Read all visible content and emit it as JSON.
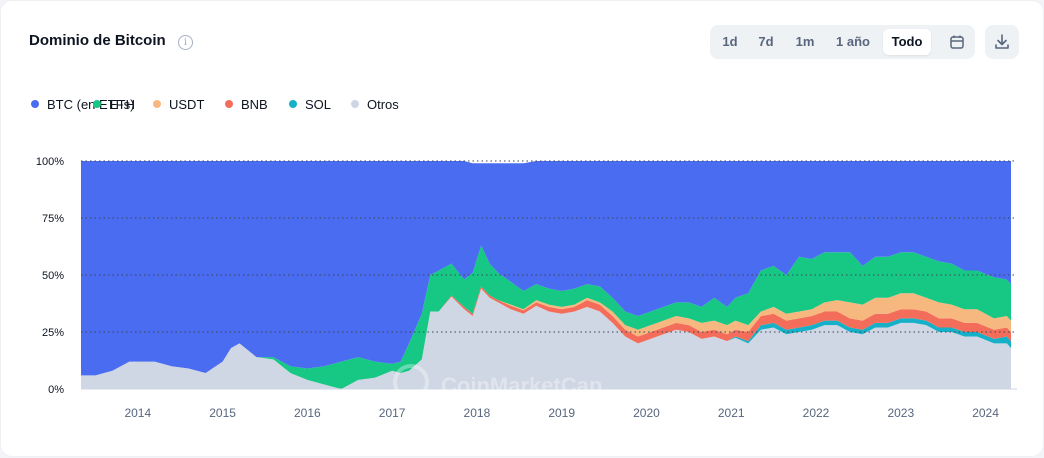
{
  "title": "Dominio de Bitcoin",
  "info_icon": "info-icon",
  "range_buttons": [
    {
      "label": "1d",
      "active": false
    },
    {
      "label": "7d",
      "active": false
    },
    {
      "label": "1m",
      "active": false
    },
    {
      "label": "1 año",
      "active": false
    },
    {
      "label": "Todo",
      "active": true
    }
  ],
  "icons": {
    "calendar": "calendar-icon",
    "download": "download-icon"
  },
  "colors": {
    "btc": "#4a6cf0",
    "eth": "#17c784",
    "usdt": "#f6b87e",
    "bnb": "#f46d5a",
    "sol": "#16b0c8",
    "others": "#cfd6e4"
  },
  "legend": [
    {
      "label": "BTC (en ETFs)",
      "color": "#4a6cf0"
    },
    {
      "label": "ETH",
      "color": "#17c784"
    },
    {
      "label": "USDT",
      "color": "#f6b87e"
    },
    {
      "label": "BNB",
      "color": "#f46d5a"
    },
    {
      "label": "SOL",
      "color": "#16b0c8"
    },
    {
      "label": "Otros",
      "color": "#cfd6e4"
    }
  ],
  "watermark": "CoinMarketCap",
  "chart_data": {
    "type": "area",
    "stacked": true,
    "x": [
      2013.33,
      2013.5,
      2013.7,
      2013.9,
      2014.0,
      2014.2,
      2014.4,
      2014.6,
      2014.8,
      2015.0,
      2015.1,
      2015.2,
      2015.4,
      2015.6,
      2015.8,
      2016.0,
      2016.2,
      2016.4,
      2016.6,
      2016.8,
      2017.0,
      2017.1,
      2017.2,
      2017.35,
      2017.45,
      2017.55,
      2017.7,
      2017.85,
      2017.95,
      2018.05,
      2018.15,
      2018.25,
      2018.4,
      2018.55,
      2018.7,
      2018.85,
      2019.0,
      2019.15,
      2019.3,
      2019.45,
      2019.6,
      2019.75,
      2019.9,
      2020.05,
      2020.2,
      2020.35,
      2020.5,
      2020.65,
      2020.8,
      2020.95,
      2021.05,
      2021.2,
      2021.35,
      2021.5,
      2021.65,
      2021.8,
      2021.95,
      2022.1,
      2022.25,
      2022.4,
      2022.55,
      2022.7,
      2022.85,
      2023.0,
      2023.15,
      2023.3,
      2023.45,
      2023.6,
      2023.75,
      2023.9,
      2024.1,
      2024.25,
      2024.3
    ],
    "series": [
      {
        "name": "BTC (en ETFs)",
        "color": "#4a6cf0",
        "values": [
          94,
          94,
          92,
          88,
          88,
          88,
          90,
          91,
          93,
          88,
          82,
          80,
          86,
          86,
          90,
          91,
          90,
          88,
          86,
          88,
          89,
          88,
          80,
          67,
          50,
          48,
          45,
          52,
          48,
          36,
          44,
          48,
          52,
          56,
          54,
          56,
          57,
          56,
          54,
          55,
          60,
          66,
          68,
          66,
          64,
          62,
          62,
          64,
          60,
          64,
          60,
          58,
          48,
          46,
          50,
          42,
          43,
          40,
          40,
          40,
          46,
          42,
          42,
          40,
          40,
          42,
          44,
          45,
          48,
          48,
          51,
          52,
          54
        ]
      },
      {
        "name": "ETH",
        "color": "#17c784",
        "values": [
          0,
          0,
          0,
          0,
          0,
          0,
          0,
          0,
          0,
          0,
          0,
          0,
          0,
          1,
          3,
          5,
          8,
          12,
          10,
          7,
          3,
          5,
          12,
          20,
          16,
          18,
          14,
          12,
          18,
          18,
          14,
          12,
          10,
          8,
          7,
          7,
          7,
          7,
          6,
          7,
          6,
          6,
          6,
          6,
          6,
          6,
          7,
          7,
          10,
          8,
          10,
          14,
          18,
          18,
          17,
          24,
          22,
          22,
          21,
          22,
          17,
          18,
          18,
          18,
          18,
          18,
          18,
          18,
          17,
          17,
          18,
          16,
          16
        ]
      },
      {
        "name": "USDT",
        "color": "#f6b87e",
        "values": [
          0,
          0,
          0,
          0,
          0,
          0,
          0,
          0,
          0,
          0,
          0,
          0,
          0,
          0,
          0,
          0,
          0,
          0,
          0,
          0,
          0,
          0,
          0,
          0,
          0,
          0,
          0,
          0,
          0,
          0,
          0,
          0,
          0.5,
          0.5,
          1,
          1,
          1,
          1,
          1,
          1,
          2,
          2,
          3,
          3,
          3,
          3,
          3,
          4,
          4,
          4,
          4,
          3,
          2,
          3,
          3,
          3,
          3,
          4,
          5,
          7,
          7,
          7,
          7,
          7,
          7,
          6,
          7,
          6,
          6,
          6,
          5,
          5,
          5
        ]
      },
      {
        "name": "BNB",
        "color": "#f46d5a",
        "values": [
          0,
          0,
          0,
          0,
          0,
          0,
          0,
          0,
          0,
          0,
          0,
          0,
          0,
          0,
          0,
          0,
          0,
          0,
          0,
          0,
          0,
          0,
          0,
          0,
          0,
          0,
          0.5,
          1,
          1,
          1,
          1,
          1,
          1.5,
          1.5,
          1.5,
          2,
          2,
          2,
          3,
          3,
          3,
          3,
          3,
          3,
          3,
          3,
          3,
          3,
          3,
          3,
          3,
          4,
          4,
          4,
          4,
          4,
          4,
          4,
          4,
          4,
          4,
          4,
          4,
          4,
          4,
          4,
          4,
          4,
          4,
          4,
          4,
          4,
          4
        ]
      },
      {
        "name": "SOL",
        "color": "#16b0c8",
        "values": [
          0,
          0,
          0,
          0,
          0,
          0,
          0,
          0,
          0,
          0,
          0,
          0,
          0,
          0,
          0,
          0,
          0,
          0,
          0,
          0,
          0,
          0,
          0,
          0,
          0,
          0,
          0,
          0,
          0,
          0,
          0,
          0,
          0,
          0,
          0,
          0,
          0,
          0,
          0,
          0,
          0,
          0,
          0,
          0,
          0,
          0,
          0,
          0,
          0,
          0,
          0.5,
          1,
          2,
          2,
          2,
          2,
          2,
          2,
          2,
          2,
          2,
          2,
          2,
          2,
          2,
          2,
          2,
          2,
          2,
          2,
          2,
          3,
          3
        ]
      },
      {
        "name": "Otros",
        "color": "#cfd6e4",
        "values": [
          6,
          6,
          8,
          12,
          12,
          12,
          10,
          9,
          7,
          12,
          18,
          20,
          14,
          13,
          7,
          4,
          2,
          0,
          4,
          5,
          8,
          7,
          8,
          13,
          34,
          34,
          40.5,
          35,
          32,
          44,
          40,
          38,
          35,
          33,
          36.5,
          34,
          33,
          34,
          36,
          34,
          29,
          23,
          20,
          22,
          24,
          26,
          25,
          22,
          23,
          21,
          22.5,
          20,
          26,
          27,
          24,
          25,
          26,
          28,
          28,
          25,
          24,
          27,
          27,
          29,
          29,
          28,
          25,
          25,
          23,
          23,
          20,
          20,
          18
        ]
      }
    ],
    "xticks": [
      "2014",
      "2015",
      "2016",
      "2017",
      "2018",
      "2019",
      "2020",
      "2021",
      "2022",
      "2023",
      "2024"
    ],
    "yticks": [
      "0%",
      "25%",
      "50%",
      "75%",
      "100%"
    ],
    "xlim": [
      2013.33,
      2024.3
    ],
    "ylim": [
      0,
      100
    ],
    "grid": true,
    "legend_position": "top-left"
  }
}
